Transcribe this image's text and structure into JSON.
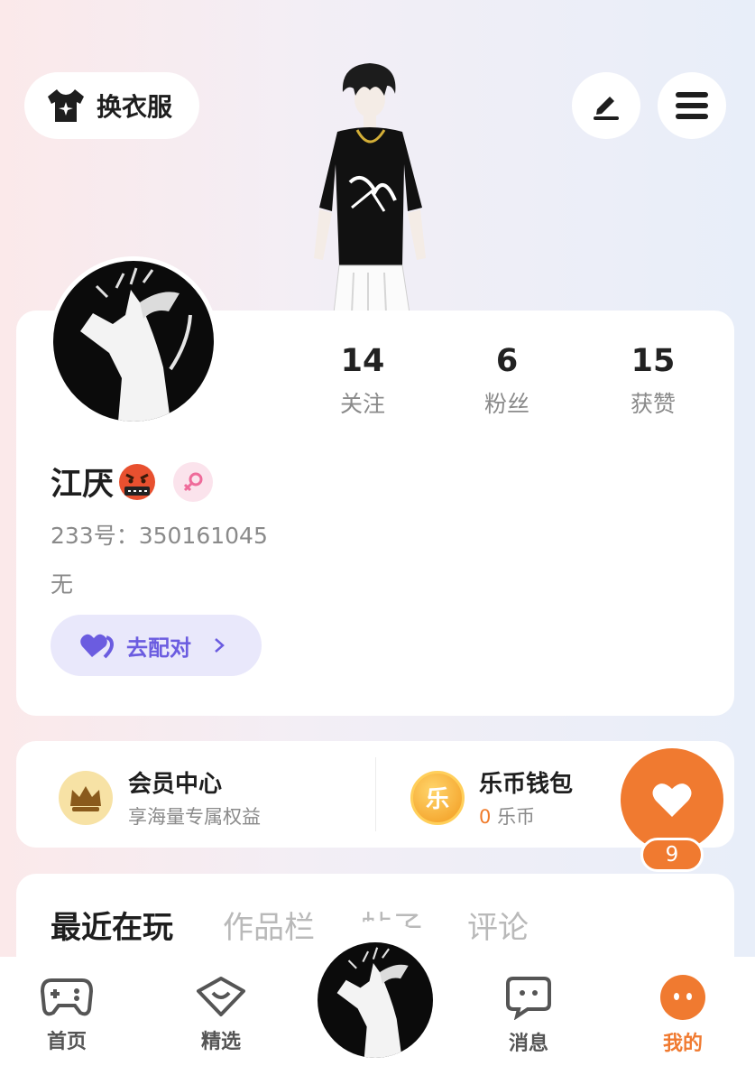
{
  "header": {
    "wardrobe_label": "换衣服",
    "edit_icon": "pencil-icon",
    "menu_icon": "hamburger-icon"
  },
  "profile": {
    "stats": [
      {
        "value": "14",
        "label": "关注"
      },
      {
        "value": "6",
        "label": "粉丝"
      },
      {
        "value": "15",
        "label": "获赞"
      }
    ],
    "name": "江厌",
    "name_emoji": "cursing-face-emoji",
    "gender": "female",
    "uid": "233号：350161045",
    "bio": "无",
    "match_label": "去配对"
  },
  "entries": {
    "vip": {
      "title": "会员中心",
      "subtitle": "享海量专属权益"
    },
    "wallet": {
      "title": "乐币钱包",
      "coin_count": "0",
      "coin_unit": "乐币",
      "icon_char": "乐"
    }
  },
  "heart_fab": {
    "count": "9"
  },
  "tabs": [
    "最近在玩",
    "作品栏",
    "帖子",
    "评论"
  ],
  "nav": [
    {
      "label": "首页",
      "icon": "gamepad-icon"
    },
    {
      "label": "精选",
      "icon": "heart-box-icon"
    },
    {
      "label": "消息",
      "icon": "chat-icon"
    },
    {
      "label": "我的",
      "icon": "profile-dots-icon"
    }
  ],
  "colors": {
    "accent": "#f07a30",
    "match_purple": "#6b5ce0",
    "gold": "#f2c14e"
  }
}
